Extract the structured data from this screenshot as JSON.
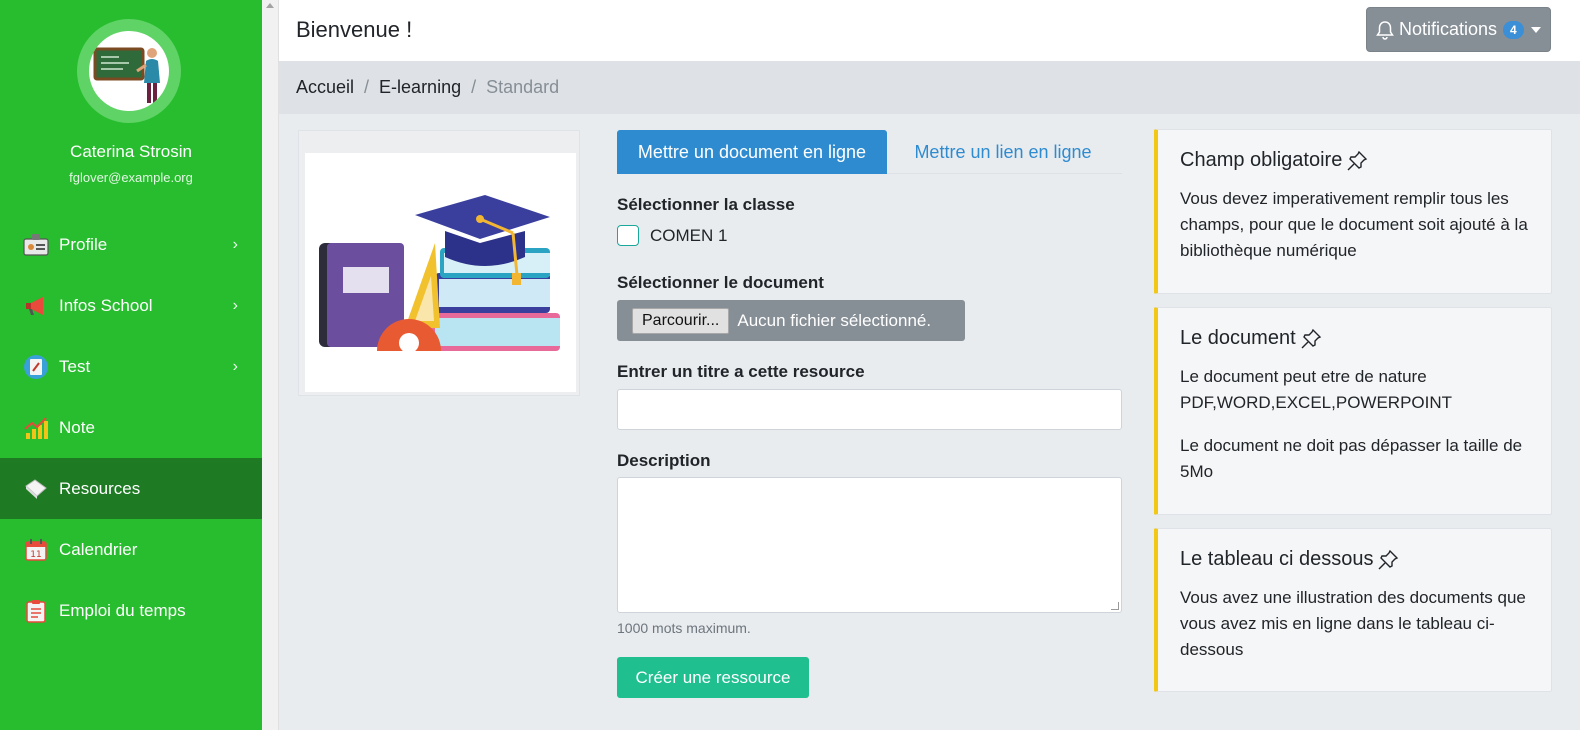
{
  "sidebar": {
    "user_name": "Caterina Strosin",
    "user_email": "fglover@example.org",
    "items": [
      {
        "label": "Profile",
        "icon": "id-card-icon",
        "has_chevron": true
      },
      {
        "label": "Infos School",
        "icon": "megaphone-icon",
        "has_chevron": true
      },
      {
        "label": "Test",
        "icon": "test-badge-icon",
        "has_chevron": true
      },
      {
        "label": "Note",
        "icon": "bar-chart-icon",
        "has_chevron": false
      },
      {
        "label": "Resources",
        "icon": "book-icon",
        "has_chevron": false,
        "active": true
      },
      {
        "label": "Calendrier",
        "icon": "calendar-icon",
        "has_chevron": false
      },
      {
        "label": "Emploi du temps",
        "icon": "clipboard-icon",
        "has_chevron": false
      }
    ],
    "colors": {
      "background": "#27bd2e",
      "active": "#1e7b24"
    }
  },
  "header": {
    "title": "Bienvenue !",
    "notifications": {
      "label": "Notifications",
      "count": "4"
    }
  },
  "breadcrumb": {
    "items": [
      "Accueil",
      "E-learning"
    ],
    "current": "Standard"
  },
  "form": {
    "tabs": [
      "Mettre un document en ligne",
      "Mettre un lien en ligne"
    ],
    "class_label": "Sélectionner la classe",
    "class_option": "COMEN 1",
    "document_label": "Sélectionner le document",
    "browse_button": "Parcourir...",
    "file_status": "Aucun fichier sélectionné.",
    "title_label": "Entrer un titre a cette resource",
    "title_value": "",
    "description_label": "Description",
    "description_hint": "1000 mots maximum.",
    "submit": "Créer une ressource"
  },
  "info_cards": [
    {
      "title": "Champ obligatoire",
      "paragraphs": [
        "Vous devez imperativement remplir tous les champs, pour que le document soit ajouté à la bibliothèque numérique"
      ]
    },
    {
      "title": "Le document",
      "paragraphs": [
        "Le document peut etre de nature PDF,WORD,EXCEL,POWERPOINT",
        "Le document ne doit pas dépasser la taille de 5Mo"
      ]
    },
    {
      "title": "Le tableau ci dessous",
      "paragraphs": [
        "Vous avez une illustration des documents que vous avez mis en ligne dans le tableau ci-dessous"
      ]
    }
  ],
  "accent_colors": {
    "primary": "#2e8bd0",
    "success": "#1fbf8f",
    "warning": "#f3c715",
    "secondary": "#868e96"
  }
}
